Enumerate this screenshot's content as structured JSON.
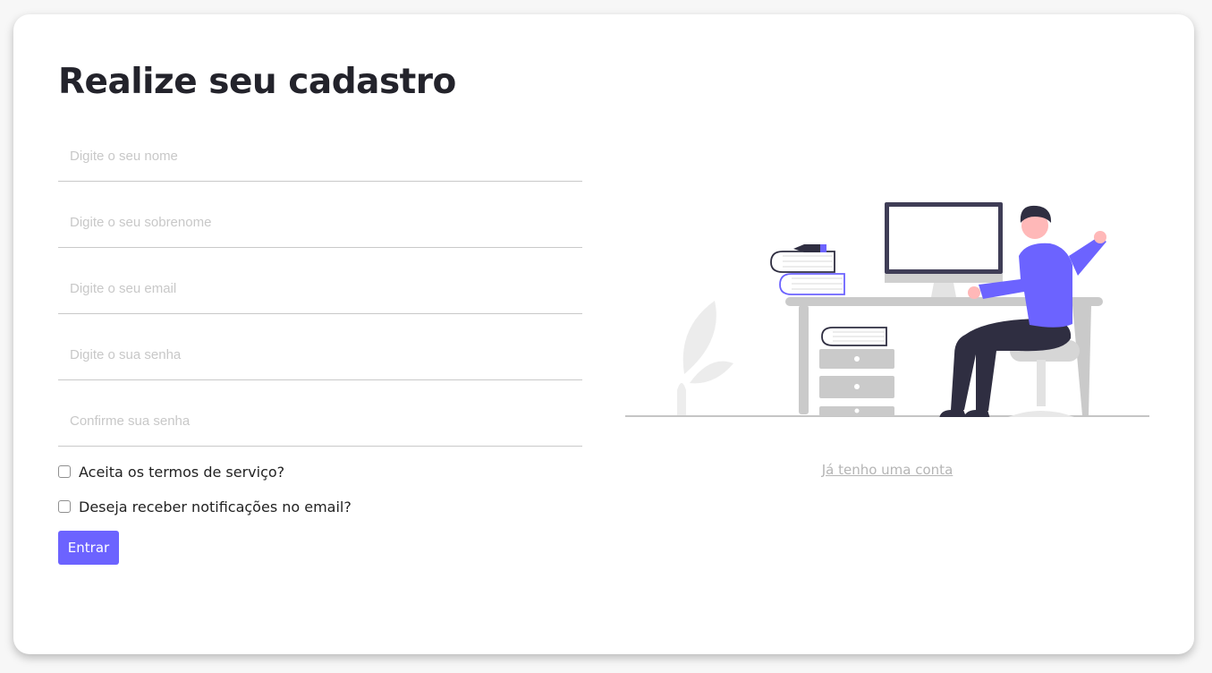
{
  "page": {
    "title": "Realize seu cadastro"
  },
  "form": {
    "first_name_placeholder": "Digite o seu nome",
    "last_name_placeholder": "Digite o seu sobrenome",
    "email_placeholder": "Digite o seu email",
    "password_placeholder": "Digite o sua senha",
    "confirm_password_placeholder": "Confirme sua senha",
    "terms_label": "Aceita os termos de serviço?",
    "notifications_label": "Deseja receber notificações no email?",
    "submit_label": "Entrar"
  },
  "aside": {
    "login_link": "Já tenho uma conta",
    "illustration": "person-at-desk-illustration"
  },
  "colors": {
    "accent": "#6c63ff",
    "dark": "#2f2e41",
    "background": "#f7f7f7",
    "card": "#ffffff"
  }
}
